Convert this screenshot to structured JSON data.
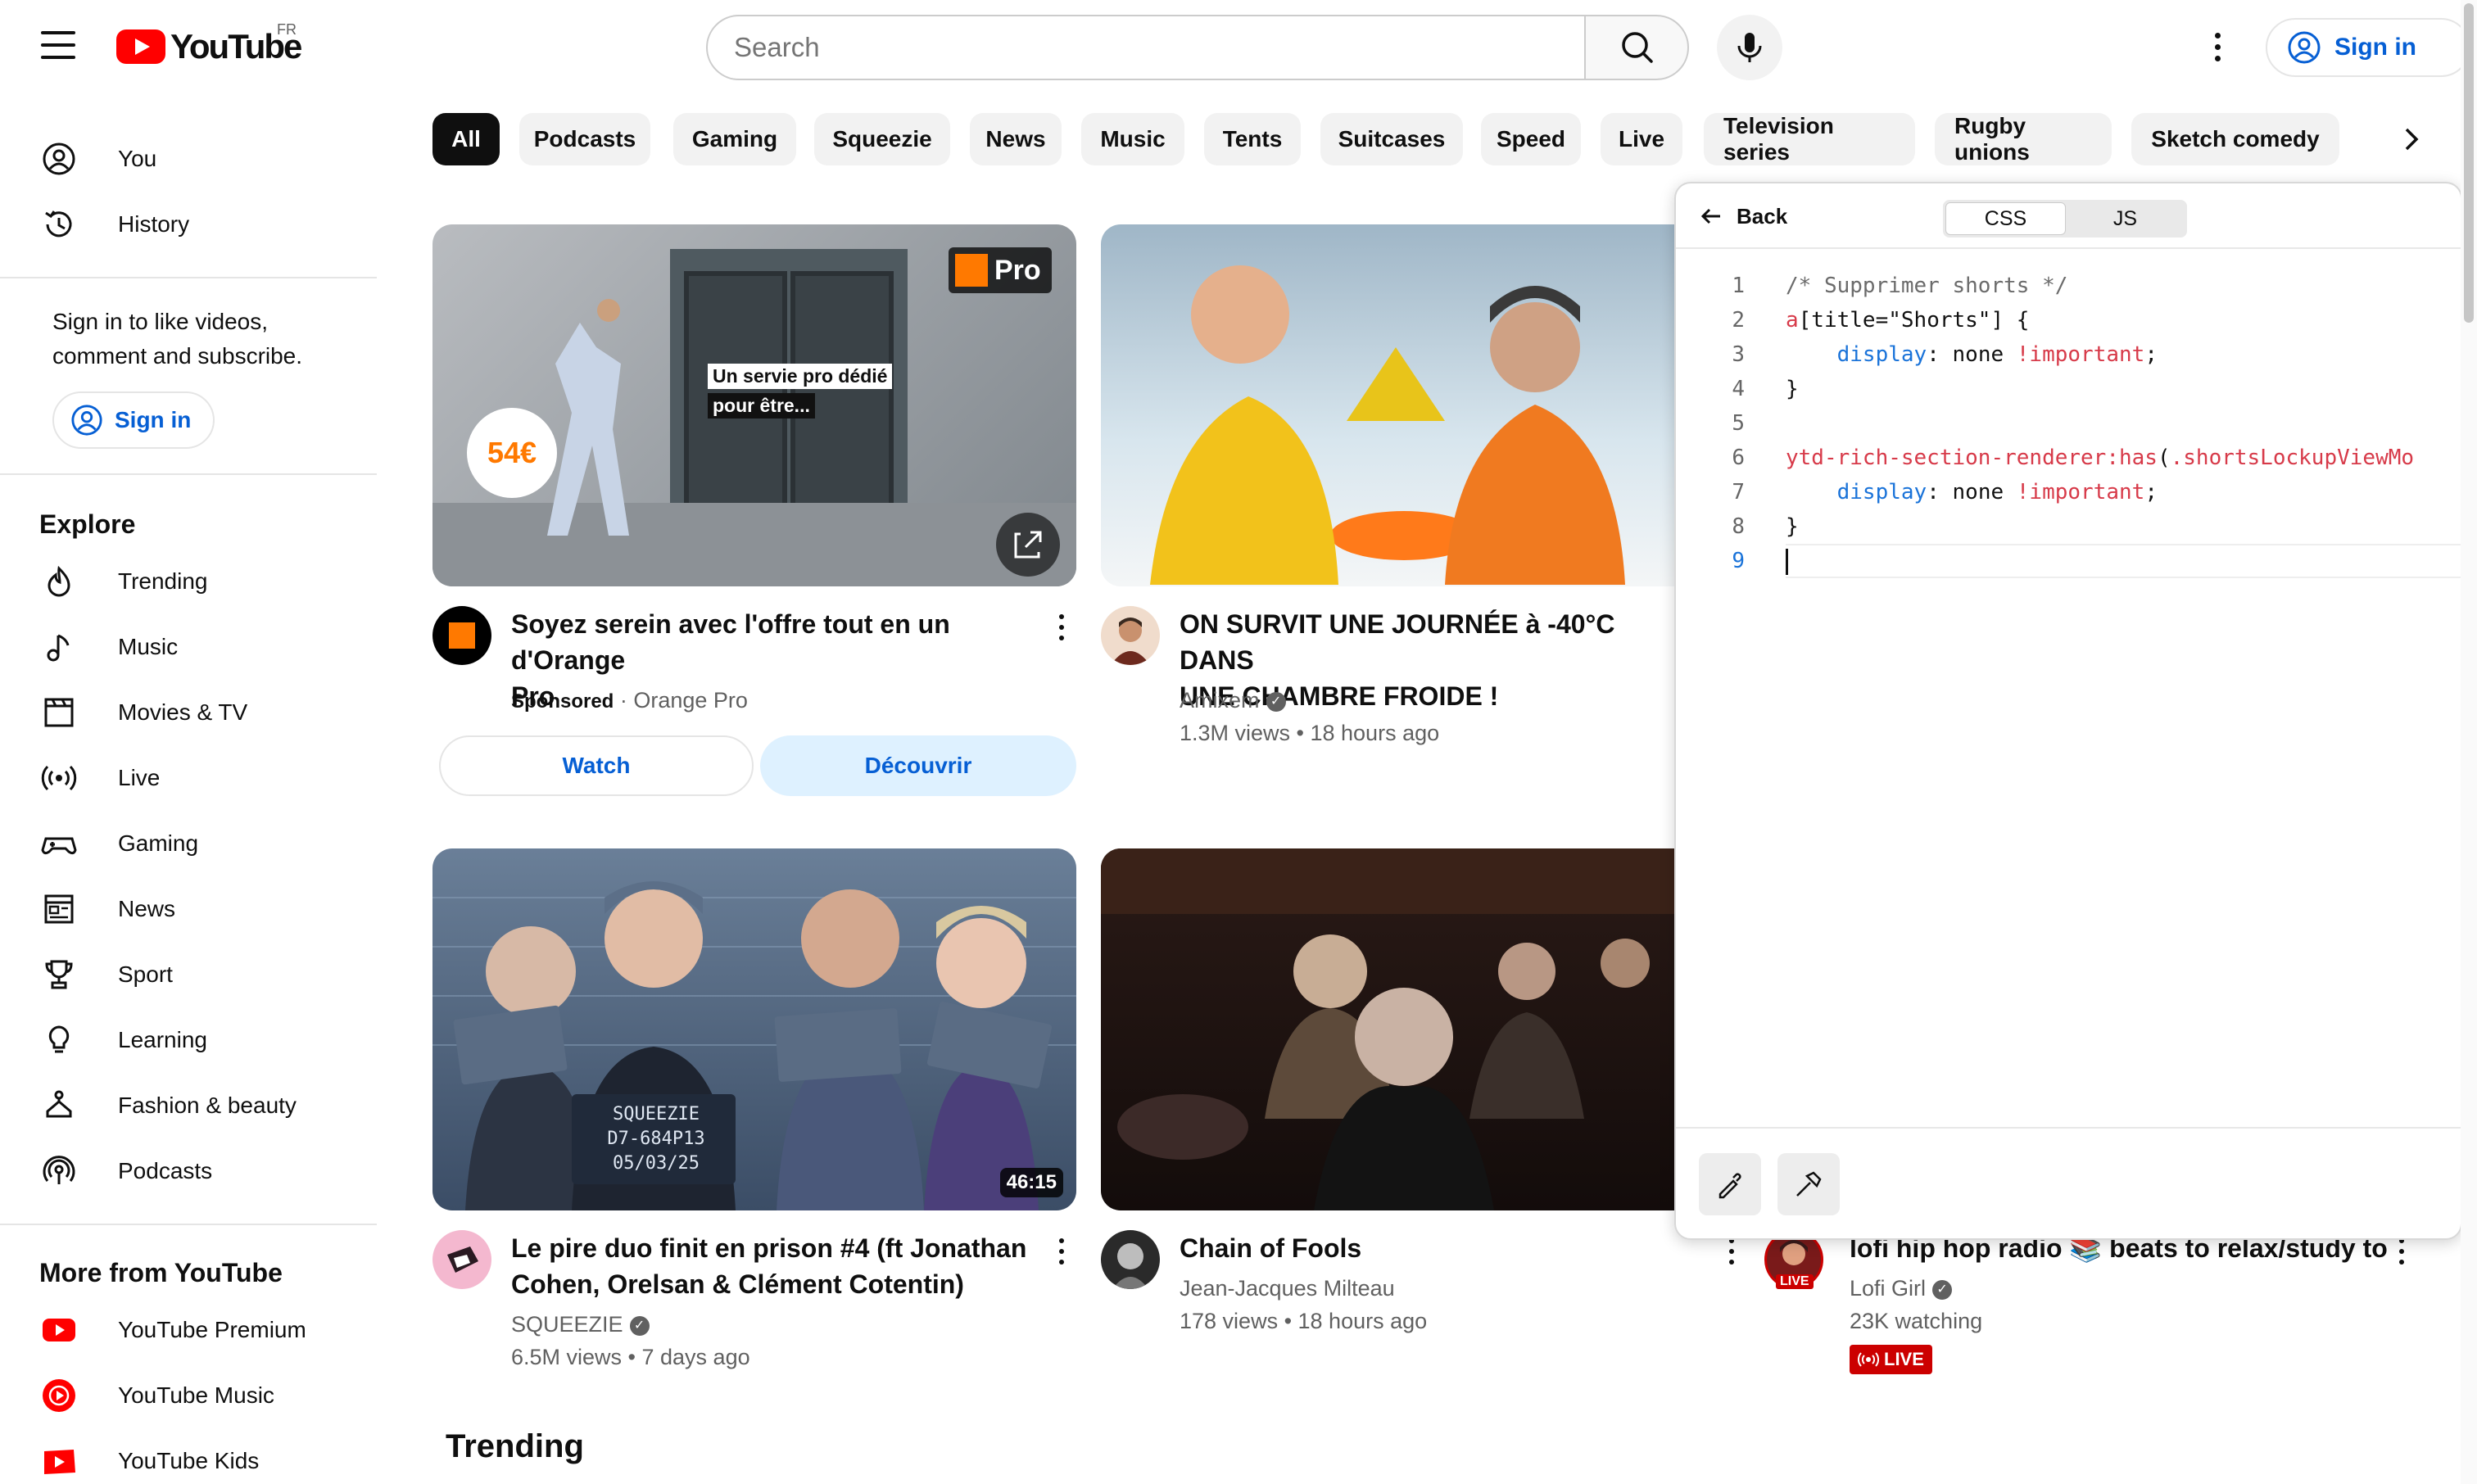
{
  "header": {
    "logo_text": "YouTube",
    "region": "FR",
    "search_placeholder": "Search",
    "sign_in": "Sign in"
  },
  "sidebar": {
    "top_items": [
      {
        "label": "You",
        "icon": "user-circle-icon"
      },
      {
        "label": "History",
        "icon": "history-icon"
      }
    ],
    "signin_prompt": "Sign in to like videos, comment and subscribe.",
    "signin_button": "Sign in",
    "explore_heading": "Explore",
    "explore_items": [
      {
        "label": "Trending",
        "icon": "trending-flame-icon"
      },
      {
        "label": "Music",
        "icon": "music-note-icon"
      },
      {
        "label": "Movies & TV",
        "icon": "clapperboard-icon"
      },
      {
        "label": "Live",
        "icon": "live-broadcast-icon"
      },
      {
        "label": "Gaming",
        "icon": "gamepad-icon"
      },
      {
        "label": "News",
        "icon": "newspaper-icon"
      },
      {
        "label": "Sport",
        "icon": "trophy-icon"
      },
      {
        "label": "Learning",
        "icon": "lightbulb-icon"
      },
      {
        "label": "Fashion & beauty",
        "icon": "hanger-icon"
      },
      {
        "label": "Podcasts",
        "icon": "podcast-icon"
      }
    ],
    "more_heading": "More from YouTube",
    "more_items": [
      {
        "label": "YouTube Premium",
        "icon": "youtube-premium-icon"
      },
      {
        "label": "YouTube Music",
        "icon": "youtube-music-icon"
      },
      {
        "label": "YouTube Kids",
        "icon": "youtube-kids-icon"
      }
    ]
  },
  "chips": [
    "All",
    "Podcasts",
    "Gaming",
    "Squeezie",
    "News",
    "Music",
    "Tents",
    "Suitcases",
    "Speed",
    "Live",
    "Television series",
    "Rugby unions",
    "Sketch comedy"
  ],
  "videos": {
    "ad": {
      "title_line1": "Soyez serein avec l'offre tout en un d'Orange",
      "title_line2": "Pro",
      "sponsored": "Sponsored",
      "channel": "Orange Pro",
      "overlay_line1": "Un servie pro dédié",
      "overlay_line2": "pour être...",
      "price": "54€",
      "badge": "Pro",
      "watch": "Watch",
      "discover": "Découvrir"
    },
    "v1": {
      "title_line1": "ON SURVIT UNE JOURNÉE à -40°C DANS",
      "title_line2": "UNE CHAMBRE FROIDE !",
      "channel": "Amixem",
      "meta": "1.3M views • 18 hours ago"
    },
    "v2": {
      "title_line1": "Le pire duo finit en prison #4 (ft Jonathan",
      "title_line2": "Cohen, Orelsan & Clément Cotentin)",
      "channel": "SQUEEZIE",
      "meta": "6.5M views • 7 days ago",
      "duration": "46:15",
      "sign_main": "SQUEEZIE\nD7-684P13\n05/03/25"
    },
    "v3": {
      "title": "Chain of Fools",
      "channel": "Jean-Jacques Milteau",
      "meta": "178 views • 18 hours ago"
    },
    "v4": {
      "title": "lofi hip hop radio 📚 beats to relax/study to",
      "channel": "Lofi Girl",
      "meta": "23K watching",
      "live": "LIVE"
    }
  },
  "trending_heading": "Trending",
  "panel": {
    "back": "Back",
    "tabs": [
      "CSS",
      "JS"
    ],
    "active_tab": "CSS",
    "code_lines": [
      "/* Supprimer shorts */",
      "a[title=\"Shorts\"] {",
      "    display: none !important;",
      "}",
      "",
      "ytd-rich-section-renderer:has(.shortsLockupViewMo",
      "    display: none !important;",
      "}",
      ""
    ]
  },
  "colors": {
    "brand_red": "#ff0000",
    "link_blue": "#065fd4",
    "chip_bg": "#f2f2f2",
    "live_red": "#cc0000"
  }
}
